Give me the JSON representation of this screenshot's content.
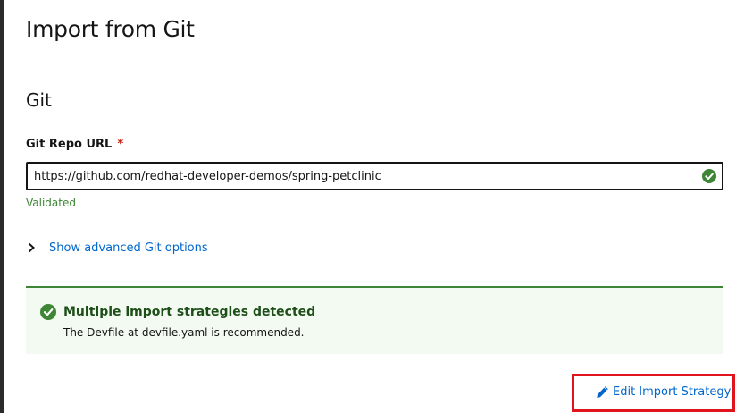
{
  "page": {
    "title": "Import from Git"
  },
  "git_section": {
    "title": "Git",
    "repo_url": {
      "label": "Git Repo URL",
      "required_marker": "*",
      "value": "https://github.com/redhat-developer-demos/spring-petclinic",
      "status_icon": "check-circle-icon",
      "helper": "Validated"
    },
    "advanced_toggle": {
      "label": "Show advanced Git options",
      "icon": "chevron-right-icon"
    }
  },
  "alert": {
    "variant": "success",
    "icon": "check-circle-icon",
    "title": "Multiple import strategies detected",
    "body": "The Devfile at devfile.yaml is recommended."
  },
  "edit_strategy": {
    "label": "Edit Import Strategy",
    "icon": "pencil-icon"
  },
  "colors": {
    "link": "#0066cc",
    "success": "#3e8635",
    "alert_bg": "#f3faf2",
    "alert_title": "#1e4f18",
    "required": "#c9190b",
    "highlight_border": "#e0141c"
  }
}
